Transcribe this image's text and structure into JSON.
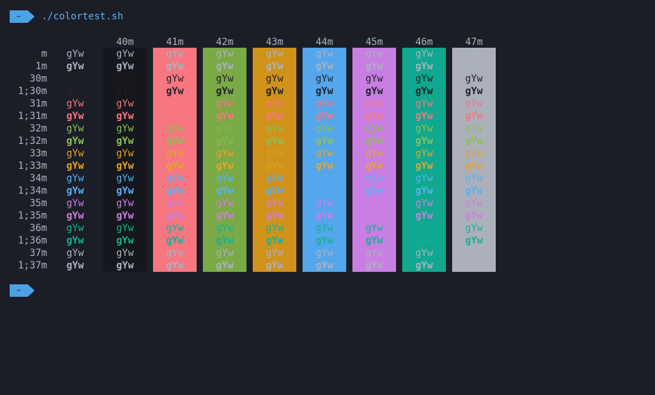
{
  "prompt": {
    "dir": "~",
    "command": "./colortest.sh"
  },
  "prompt2": {
    "dir": "~"
  },
  "headers": [
    "40m",
    "41m",
    "42m",
    "43m",
    "44m",
    "45m",
    "46m",
    "47m"
  ],
  "row_labels": [
    "m",
    "1m",
    "30m",
    "1;30m",
    "31m",
    "1;31m",
    "32m",
    "1;32m",
    "33m",
    "1;33m",
    "34m",
    "1;34m",
    "35m",
    "1;35m",
    "36m",
    "1;36m",
    "37m",
    "1;37m"
  ],
  "cell_text": "gYw",
  "colors": {
    "terminal_bg": "#1b1e27",
    "default_fg": "#abb2bf",
    "prompt_accent": "#4ba3e6",
    "bg_40m": "#15171c",
    "bg_41m": "#f77680",
    "bg_42m": "#7aaa45",
    "bg_43m": "#d19219",
    "bg_44m": "#54a6ed",
    "bg_45m": "#c97ee3",
    "bg_46m": "#10a88e",
    "bg_47m": "#abb0bb",
    "fg_30m": "#1f2229",
    "fg_31m": "#f77680",
    "fg_32m": "#8cc152",
    "fg_33m": "#e5a52b",
    "fg_34m": "#58b0f5",
    "fg_35m": "#cd7fe0",
    "fg_36m": "#14b396",
    "fg_37m": "#abb2bf"
  }
}
